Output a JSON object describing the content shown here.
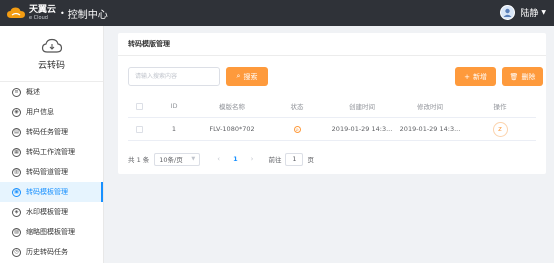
{
  "header": {
    "brand": "天翼云",
    "brand_sub": "e Cloud",
    "dot": "•",
    "title": "控制中心",
    "user_name": "陆静"
  },
  "sidebar": {
    "title": "云转码",
    "items": [
      {
        "label": "概述",
        "icon": "overview-icon",
        "active": false
      },
      {
        "label": "用户信息",
        "icon": "user-info-icon",
        "active": false
      },
      {
        "label": "转码任务管理",
        "icon": "task-icon",
        "active": false
      },
      {
        "label": "转码工作流管理",
        "icon": "workflow-icon",
        "active": false
      },
      {
        "label": "转码管道管理",
        "icon": "pipeline-icon",
        "active": false
      },
      {
        "label": "转码模板管理",
        "icon": "template-icon",
        "active": true
      },
      {
        "label": "水印模板管理",
        "icon": "watermark-icon",
        "active": false
      },
      {
        "label": "缩略图模板管理",
        "icon": "thumbnail-icon",
        "active": false
      },
      {
        "label": "历史转码任务",
        "icon": "history-icon",
        "active": false
      }
    ]
  },
  "main": {
    "card_title": "转码模版管理",
    "search_placeholder": "请输入搜索内容",
    "search_button": "搜索",
    "add_button": "新增",
    "delete_button": "删除",
    "table": {
      "columns": [
        "",
        "ID",
        "模版名称",
        "状态",
        "创建时间",
        "修改时间",
        "操作"
      ],
      "rows": [
        {
          "id": "1",
          "name": "FLV-1080*702",
          "created": "2019-01-29 14:3...",
          "modified": "2019-01-29 14:3..."
        }
      ]
    },
    "pagination": {
      "total": "共 1 条",
      "page_size": "10条/页",
      "prev": "‹",
      "current": "1",
      "next": "›",
      "goto_label": "前往",
      "goto_value": "1",
      "page_unit": "页"
    }
  },
  "colors": {
    "topbar": "#2f3238",
    "accent_orange": "#fe9a3c",
    "accent_blue": "#1890ff",
    "background": "#f0f2f5"
  }
}
